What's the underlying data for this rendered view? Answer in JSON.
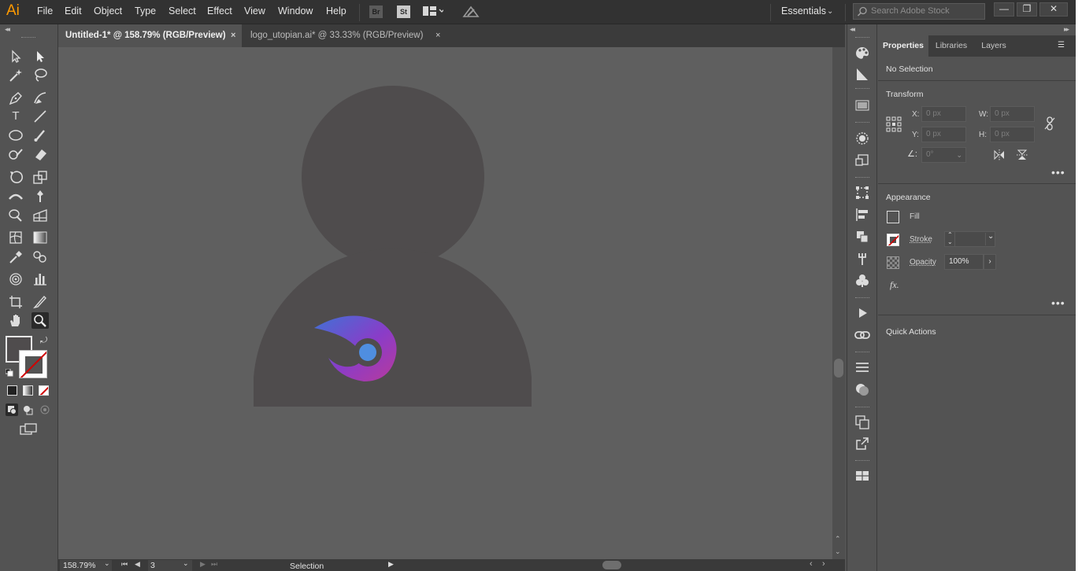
{
  "app": {
    "logo": "Ai"
  },
  "menu": [
    "File",
    "Edit",
    "Object",
    "Type",
    "Select",
    "Effect",
    "View",
    "Window",
    "Help"
  ],
  "toolbar_icons": {
    "bridge": "Br",
    "stock": "St"
  },
  "workspace": {
    "label": "Essentials"
  },
  "search": {
    "placeholder": "Search Adobe Stock"
  },
  "window_controls": {
    "minimize": "—",
    "restore": "❐",
    "close": "✕"
  },
  "tabs": [
    {
      "label": "Untitled-1* @ 158.79% (RGB/Preview)",
      "close": "×"
    },
    {
      "label": "logo_utopian.ai* @ 33.33% (RGB/Preview)",
      "close": "×"
    }
  ],
  "artwork": {
    "figure_color": "#4f4c4d",
    "logo_colors": {
      "blue": "#3f72d6",
      "purple": "#8a3cc8",
      "magenta": "#b83a9c",
      "dot": "#4f8ee0"
    }
  },
  "status": {
    "zoom": "158.79%",
    "artboard": "3",
    "tool_name": "Selection"
  },
  "properties": {
    "tabs": [
      "Properties",
      "Libraries",
      "Layers"
    ],
    "selection": "No Selection",
    "transform": {
      "title": "Transform",
      "x_label": "X:",
      "x_value": "0 px",
      "y_label": "Y:",
      "y_value": "0 px",
      "w_label": "W:",
      "w_value": "0 px",
      "h_label": "H:",
      "h_value": "0 px",
      "angle_value": "0°"
    },
    "appearance": {
      "title": "Appearance",
      "fill_label": "Fill",
      "stroke_label": "Stroke",
      "opacity_label": "Opacity",
      "opacity_value": "100%",
      "fx_label": "fx."
    },
    "quick_actions": {
      "title": "Quick Actions"
    },
    "more": "•••"
  },
  "collapse": {
    "left": "◂◂",
    "right": "▸▸"
  }
}
